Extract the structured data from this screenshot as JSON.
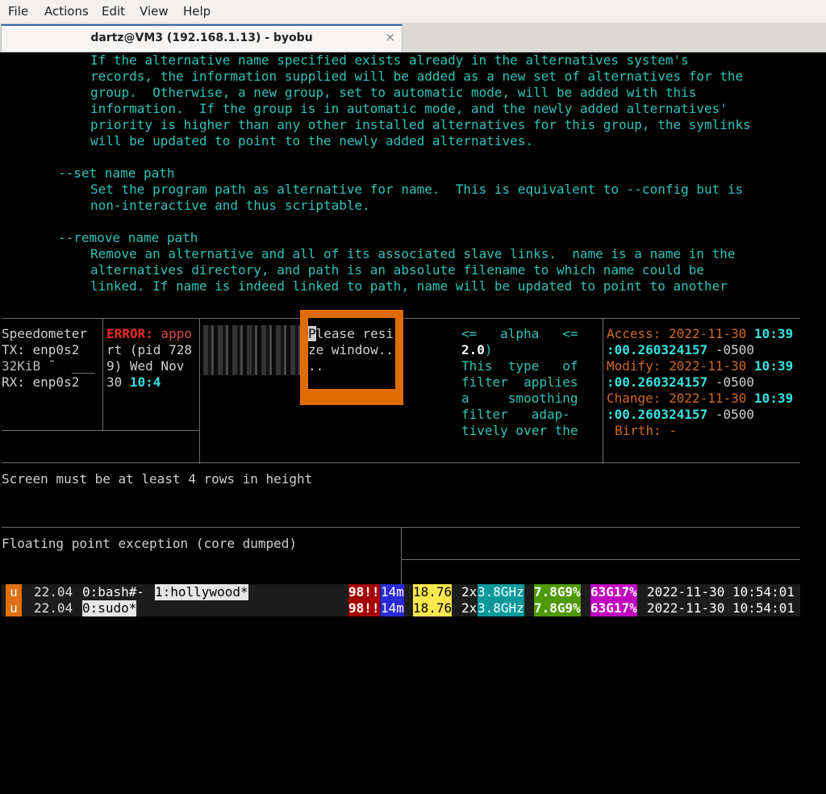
{
  "menu": {
    "file": "File",
    "actions": "Actions",
    "edit": "Edit",
    "view": "View",
    "help": "Help"
  },
  "tab": {
    "title": "dartz@VM3 (192.168.1.13) - byobu",
    "close": "×"
  },
  "man": {
    "l1": "If the alternative name specified exists already in the alternatives system's",
    "l2": "records, the information supplied will be added as a new set of alternatives for the",
    "l3": "group.  Otherwise, a new group, set to automatic mode, will be added with this",
    "l4": "information.  If the group is in automatic mode, and the newly added alternatives'",
    "l5": "priority is higher than any other installed alternatives for this group, the symlinks",
    "l6": "will be updated to point to the newly added alternatives.",
    "l7": "--set name path",
    "l8": "Set the program path as alternative for name.  This is equivalent to --config but is",
    "l9": "non-interactive and thus scriptable.",
    "l10": "--remove name path",
    "l11": "Remove an alternative and all of its associated slave links.  name is a name in the",
    "l12": "alternatives directory, and path is an absolute filename to which name could be",
    "l13": "linked. If name is indeed linked to path, name will be updated to point to another"
  },
  "speed": {
    "l1": "Speedometer",
    "l2": "TX: enp0s2",
    "l3": "32KiB ¯  ___",
    "l4": "RX: enp0s2"
  },
  "err": {
    "tag": "ERROR:",
    "l1r": " appo",
    "l2": "rt (pid 728",
    "l3": "9) Wed Nov",
    "l4a": "30 ",
    "l4b": "10:4"
  },
  "resize": {
    "cur": "P",
    "l1": "lease resi",
    "l2": "ze window..",
    "l3": ".."
  },
  "alpha": {
    "l1": "<=   alpha   <=",
    "l2": "2.0",
    "l2b": ")",
    "l3": "This  type   of",
    "l4": "filter  applies",
    "l5": "a     smoothing",
    "l6": "filter   adap-",
    "l7": "tively over the"
  },
  "stat": {
    "access": "Access:",
    "modify": "Modify:",
    "change": "Change:",
    "birth": "Birth:",
    "birth_val": "-",
    "date": "2022-11-30",
    "time": "10:39",
    "frac": ":00.260324157",
    "tz": "-0500"
  },
  "msg1": "Screen must be at least 4 rows in height",
  "msg2": "Floating point exception (core dumped)",
  "status": {
    "logo": "u",
    "ver": "22.04",
    "r1": {
      "win0": "0:bash#-",
      "win1": "1:hollywood*"
    },
    "r2": {
      "win0": "0:sudo*"
    },
    "updates": "98!!",
    "uptime": "14m",
    "load": "18.76",
    "cpus": "2x",
    "ghz": "3.8GHz",
    "mem": "7.8G9%",
    "swap": "63G17%",
    "datetime": "2022-11-30 10:54:01"
  }
}
